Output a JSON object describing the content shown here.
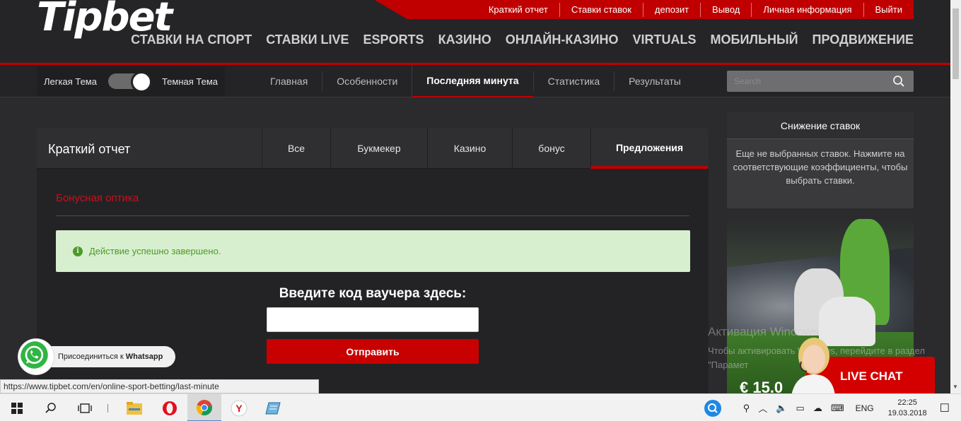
{
  "header": {
    "logo_text": "Tipbet",
    "top_links": [
      "Краткий отчет",
      "Ставки ставок",
      "депозит",
      "Вывод",
      "Личная информация",
      "Выйти"
    ],
    "main_nav": [
      "СТАВКИ НА СПОРТ",
      "СТАВКИ LIVE",
      "ESPORTS",
      "КАЗИНО",
      "ОНЛАЙН-КАЗИНО",
      "VIRTUALS",
      "МОБИЛЬНЫЙ",
      "ПРОДВИЖЕНИЕ"
    ]
  },
  "subnav": {
    "theme_light": "Легкая Тема",
    "theme_dark": "Темная Тема",
    "tabs": [
      "Главная",
      "Особенности",
      "Последняя минута",
      "Статистика",
      "Результаты"
    ],
    "active_tab": "Последняя минута",
    "search_placeholder": "Search"
  },
  "panel": {
    "title": "Краткий отчет",
    "tabs": [
      "Все",
      "Букмекер",
      "Казино",
      "бонус",
      "Предложения"
    ],
    "active_tab": "Предложения",
    "bonus_heading": "Бонусная оптика",
    "alert": "Действие успешно завершено.",
    "voucher_label": "Введите код ваучера здесь:",
    "voucher_value": "",
    "submit_label": "Отправить"
  },
  "betslip": {
    "title": "Снижение ставок",
    "text": "Еще не выбранных ставок. Нажмите на соответствующие коэффициенты, чтобы выбрать ставки."
  },
  "promo": {
    "amount": "€ 15.0"
  },
  "windows_watermark": {
    "title": "Активация Windows",
    "text": "Чтобы активировать Windows, перейдите в раздел \"Парамет"
  },
  "livechat": {
    "label": "LIVE CHAT"
  },
  "whatsapp": {
    "prefix": "Присоединиться к",
    "name": "Whatsapp"
  },
  "status_url": "https://www.tipbet.com/en/online-sport-betting/last-minute",
  "taskbar": {
    "lang": "ENG",
    "time": "22:25",
    "date": "19.03.2018"
  },
  "colors": {
    "brand_red": "#c00000",
    "success_bg": "#d8efcf",
    "success_text": "#4c9a2a"
  }
}
